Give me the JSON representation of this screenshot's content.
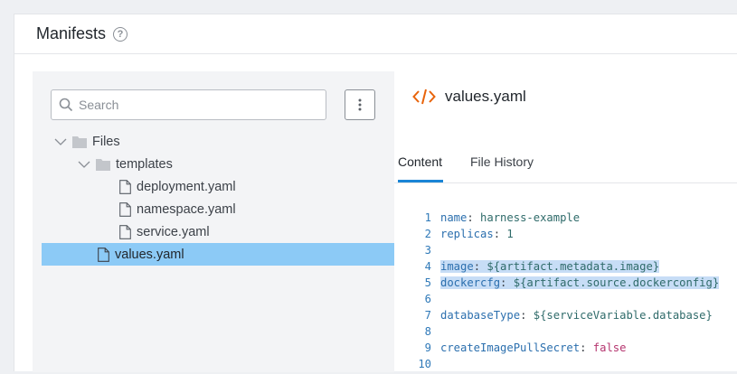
{
  "section": {
    "title": "Manifests"
  },
  "search": {
    "placeholder": "Search"
  },
  "tree": [
    {
      "label": "Files",
      "type": "folder",
      "expanded": true,
      "level": 0
    },
    {
      "label": "templates",
      "type": "folder",
      "expanded": true,
      "level": 1
    },
    {
      "label": "deployment.yaml",
      "type": "file",
      "level": 2
    },
    {
      "label": "namespace.yaml",
      "type": "file",
      "level": 2
    },
    {
      "label": "service.yaml",
      "type": "file",
      "level": 2
    },
    {
      "label": "values.yaml",
      "type": "file",
      "level": 1,
      "selected": true
    }
  ],
  "file": {
    "name": "values.yaml"
  },
  "tabs": {
    "content": "Content",
    "history": "File History"
  },
  "code": [
    {
      "n": "1",
      "key": "name",
      "value": "harness-example",
      "kind": "str"
    },
    {
      "n": "2",
      "key": "replicas",
      "value": "1",
      "kind": "str"
    },
    {
      "n": "3",
      "key": "",
      "value": "",
      "kind": "empty"
    },
    {
      "n": "4",
      "key": "image",
      "value": "${artifact.metadata.image}",
      "kind": "str",
      "highlight": true
    },
    {
      "n": "5",
      "key": "dockercfg",
      "value": "${artifact.source.dockerconfig}",
      "kind": "str",
      "highlight": true
    },
    {
      "n": "6",
      "key": "",
      "value": "",
      "kind": "empty"
    },
    {
      "n": "7",
      "key": "databaseType",
      "value": "${serviceVariable.database}",
      "kind": "str"
    },
    {
      "n": "8",
      "key": "",
      "value": "",
      "kind": "empty"
    },
    {
      "n": "9",
      "key": "createImagePullSecret",
      "value": "false",
      "kind": "bool"
    },
    {
      "n": "10",
      "key": "",
      "value": "",
      "kind": "empty"
    }
  ],
  "colors": {
    "accent": "#1a85d6",
    "selected_row": "#8ccaf6",
    "code_icon": "#e8630a"
  }
}
